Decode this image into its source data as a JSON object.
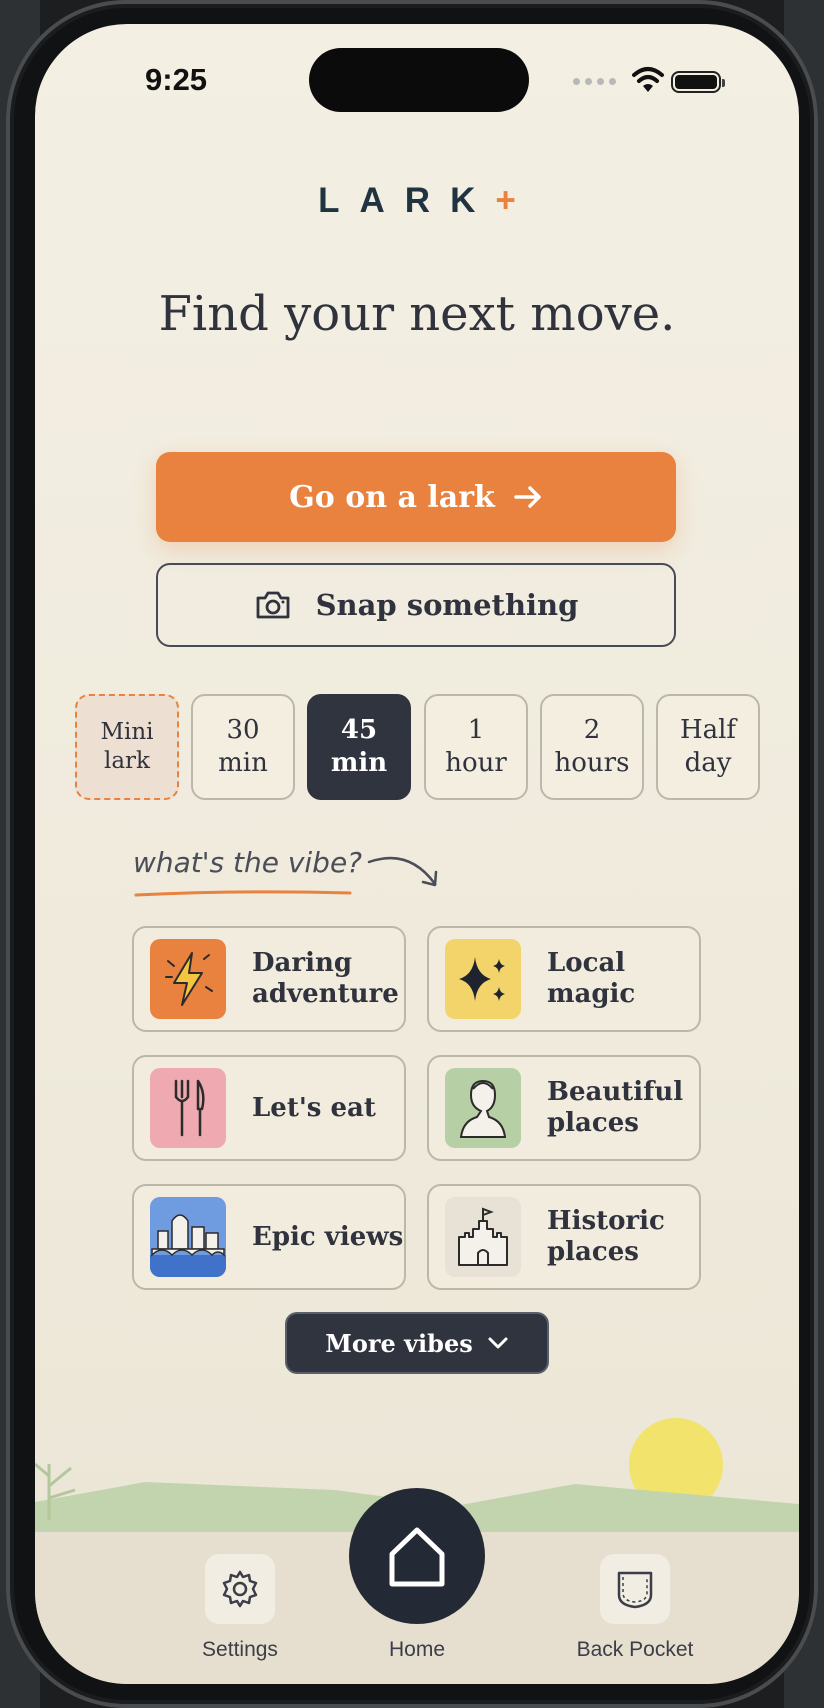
{
  "status": {
    "time": "9:25"
  },
  "logo": {
    "text": "LARK",
    "mark": "+"
  },
  "headline": "Find your next move.",
  "primary_button": {
    "label": "Go on a lark",
    "icon": "arrow-right-icon"
  },
  "secondary_button": {
    "label": "Snap something",
    "icon": "camera-icon"
  },
  "durations": [
    {
      "line1": "Mini",
      "line2": "lark",
      "state": "dashed"
    },
    {
      "line1": "30",
      "line2": "min",
      "state": "default"
    },
    {
      "line1": "45",
      "line2": "min",
      "state": "selected"
    },
    {
      "line1": "1",
      "line2": "hour",
      "state": "default"
    },
    {
      "line1": "2",
      "line2": "hours",
      "state": "default"
    },
    {
      "line1": "Half",
      "line2": "day",
      "state": "default"
    }
  ],
  "vibe_prompt": "what's the vibe?",
  "vibes": [
    {
      "line1": "Daring",
      "line2": "adventure",
      "icon": "lightning-icon",
      "color": "#e8823e"
    },
    {
      "line1": "Local",
      "line2": "magic",
      "icon": "sparkle-icon",
      "color": "#f3d46a"
    },
    {
      "line1": "Let's eat",
      "line2": "",
      "icon": "fork-knife-icon",
      "color": "#eeaab0"
    },
    {
      "line1": "Beautiful",
      "line2": "places",
      "icon": "statue-bust-icon",
      "color": "#b7cfa5"
    },
    {
      "line1": "Epic views",
      "line2": "",
      "icon": "city-bridge-icon",
      "color": "#6f9be0"
    },
    {
      "line1": "Historic",
      "line2": "places",
      "icon": "castle-icon",
      "color": "#e8e2d6"
    }
  ],
  "more_vibes": {
    "label": "More vibes",
    "icon": "chevron-down-icon"
  },
  "tabs": {
    "settings": {
      "label": "Settings",
      "icon": "gear-icon"
    },
    "home": {
      "label": "Home",
      "icon": "home-icon"
    },
    "back_pocket": {
      "label": "Back Pocket",
      "icon": "pocket-icon"
    }
  },
  "colors": {
    "accent": "#e8823e",
    "dark": "#30343f",
    "background": "#f1ecdf"
  }
}
